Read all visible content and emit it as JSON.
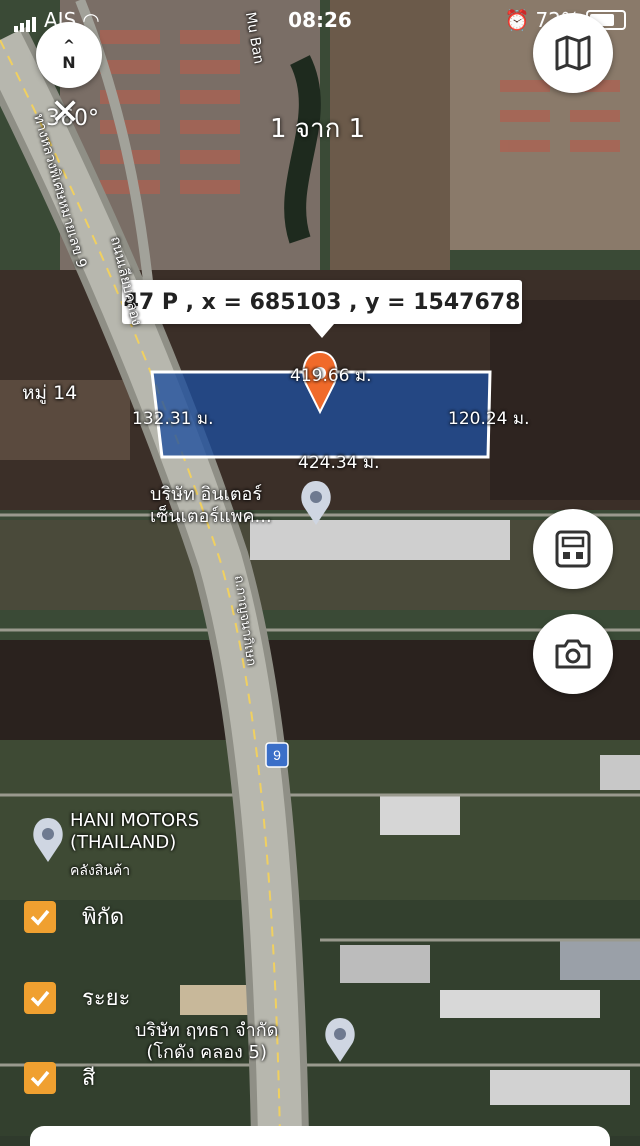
{
  "status_bar": {
    "carrier": "AIS",
    "time": "08:26",
    "battery": "72%"
  },
  "compass": {
    "label": "N"
  },
  "view_360": {
    "label": "360°"
  },
  "page_indicator": "1 จาก 1",
  "callout": {
    "text": "47 P , x = 685103 , y = 1547678"
  },
  "plot": {
    "top_length": "419.66 ม.",
    "bottom_length": "424.34 ม.",
    "left_length": "132.31 ม.",
    "right_length": "120.24 ม."
  },
  "map_labels": {
    "village": "หมู่ 14",
    "road_a": "ทางหลวงพิเศษหมายเลข 9",
    "road_b": "ถนนเลียบคลอง",
    "road_c": "Mu Ban",
    "road_d": "ถ.กาญจนาภิเษก",
    "highway_shield": "9"
  },
  "pois": [
    {
      "name": "บริษัท อินเตอร์\nเซ็นเตอร์แพค..."
    },
    {
      "name": "HANI MOTORS\n(THAILAND)",
      "sub": "คลังสินค้า"
    },
    {
      "name": "บริษัท ฤทธา จำกัด\n(โกดัง คลอง 5)"
    }
  ],
  "checkboxes": [
    {
      "label": "พิกัด",
      "checked": true
    },
    {
      "label": "ระยะ",
      "checked": true
    },
    {
      "label": "สี",
      "checked": true
    }
  ],
  "colors": {
    "plot_fill": "#1d4e9e",
    "pin": "#f06a2a",
    "checkbox": "#f0a030"
  }
}
